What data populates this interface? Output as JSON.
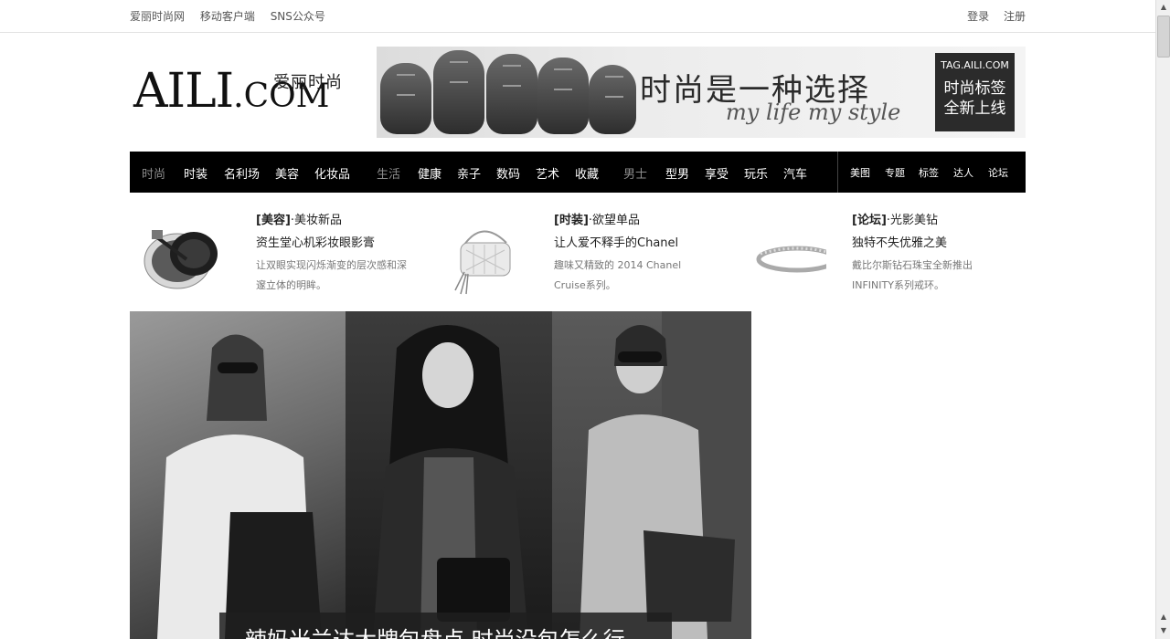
{
  "topbar": {
    "left_links": [
      "爱丽时尚网",
      "移动客户端",
      "SNS公众号"
    ],
    "right_links": [
      "登录",
      "注册"
    ]
  },
  "logo": {
    "main": "AILI",
    "dot": ".",
    "com": "COM",
    "cn": "爱丽时尚"
  },
  "banner": {
    "headline": "时尚是一种选择",
    "sub": "my life my style",
    "tag_domain": "TAG.AILI.COM",
    "tag_line1": "时尚标签",
    "tag_line2": "全新上线"
  },
  "nav": {
    "groups": [
      {
        "category": "时尚",
        "items": [
          "时装",
          "名利场",
          "美容",
          "化妆品"
        ]
      },
      {
        "category": "生活",
        "items": [
          "健康",
          "亲子",
          "数码",
          "艺术",
          "收藏"
        ]
      },
      {
        "category": "男士",
        "items": [
          "型男",
          "享受",
          "玩乐",
          "汽车"
        ]
      }
    ],
    "right": [
      "美图",
      "专题",
      "标签",
      "达人",
      "论坛"
    ]
  },
  "features": [
    {
      "section": "[美容]",
      "sub": "·美妆新品",
      "title": "资生堂心机彩妆眼影膏",
      "desc": "让双眼实现闪烁渐变的层次感和深邃立体的明眸。",
      "icon": "eyeshadow-compact-icon"
    },
    {
      "section": "[时装]",
      "sub": "·欲望单品",
      "title": "让人爱不释手的Chanel",
      "desc": "趣味又精致的 2014 Chanel Cruise系列。",
      "icon": "chanel-bag-icon"
    },
    {
      "section": "[论坛]",
      "sub": "·光影美钻",
      "title": "独特不失优雅之美",
      "desc": "戴比尔斯钻石珠宝全新推出INFINITY系列戒环。",
      "icon": "diamond-ring-icon"
    }
  ],
  "hero": {
    "caption": "辣妈米兰达大牌包盘点 时尚没包怎么行"
  },
  "colors": {
    "nav_bg": "#000000",
    "nav_category": "#8c8c8c",
    "tag_box": "#2b2b2b"
  }
}
